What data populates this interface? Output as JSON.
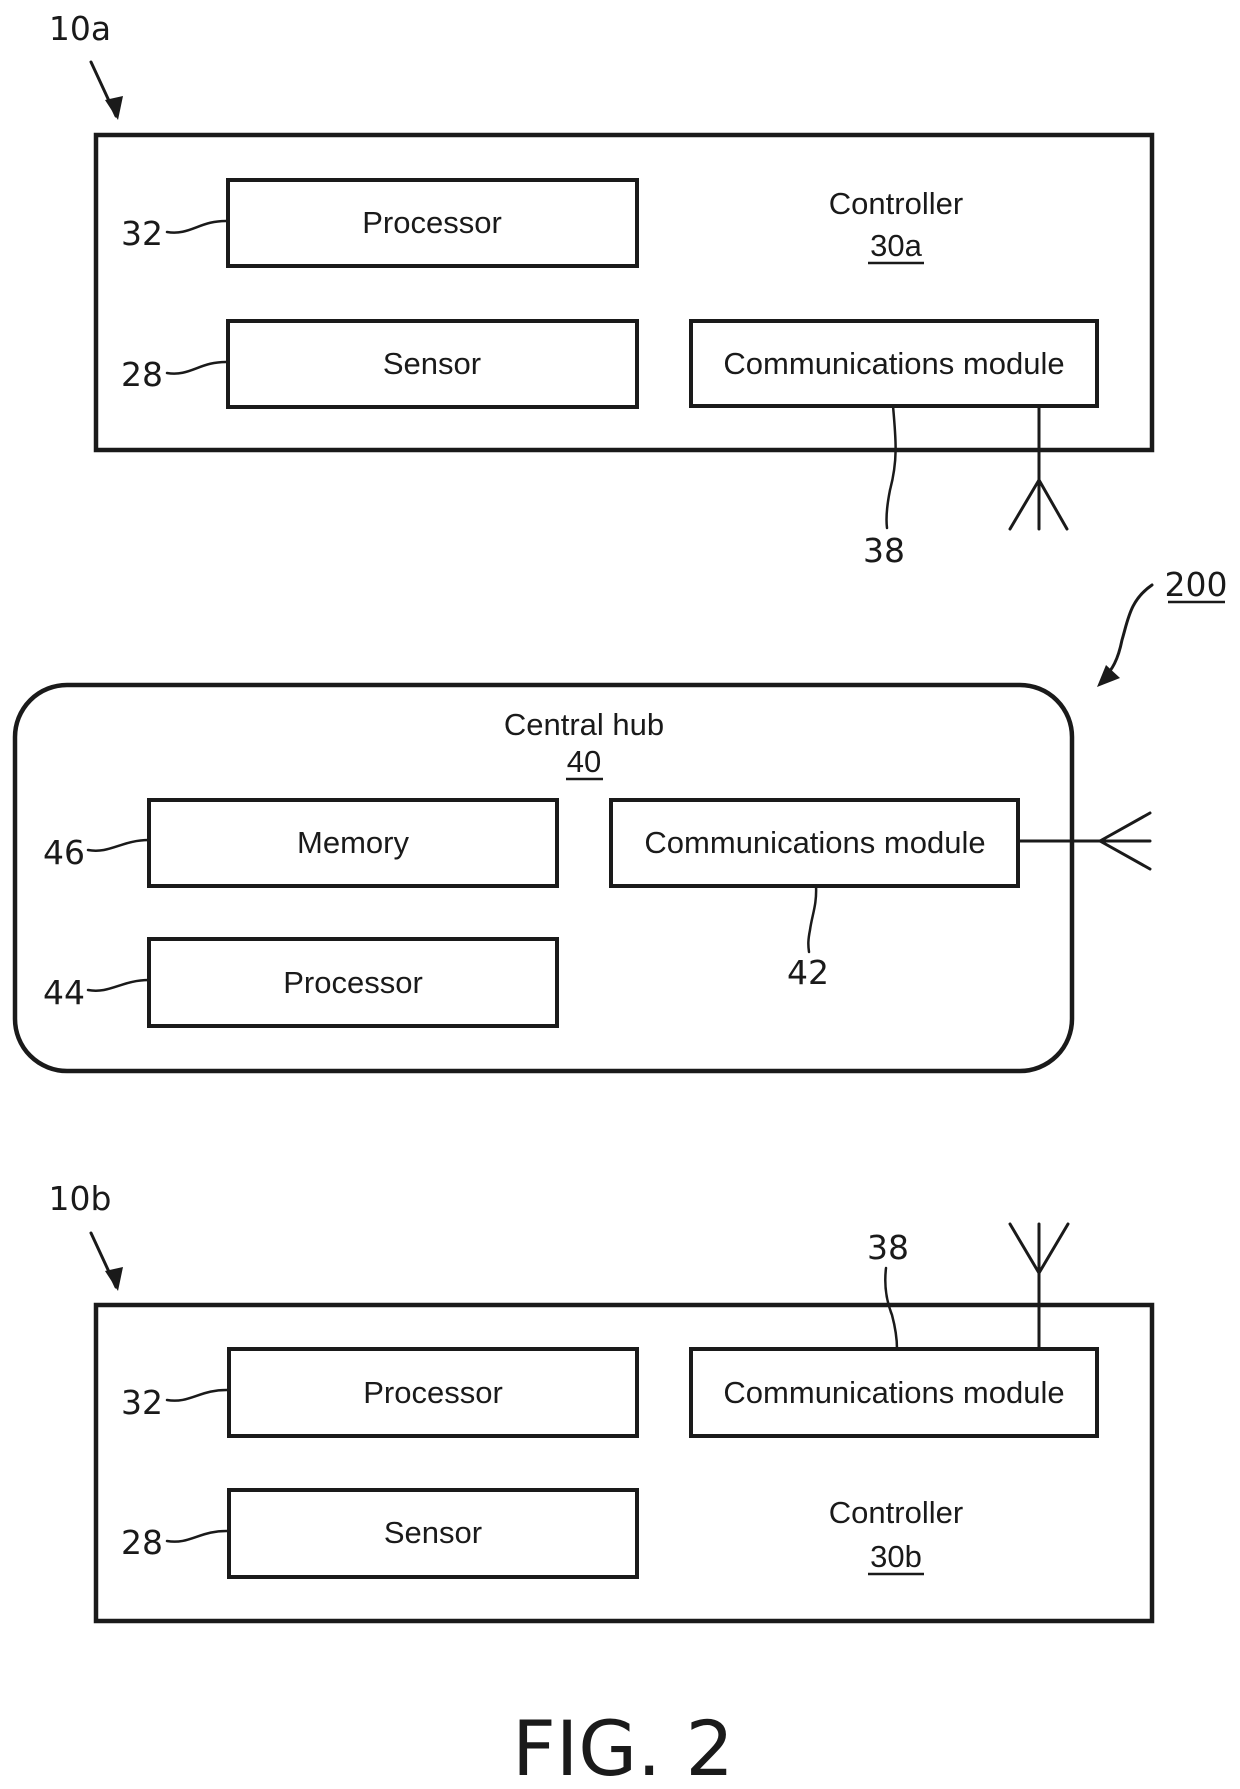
{
  "figure": {
    "caption": "FIG. 2"
  },
  "system": {
    "ref": "200"
  },
  "device_a": {
    "ref": "10a",
    "controller": {
      "title": "Controller",
      "ref": "30a"
    },
    "processor": {
      "label": "Processor",
      "ref": "32"
    },
    "sensor": {
      "label": "Sensor",
      "ref": "28"
    },
    "comms": {
      "label": "Communications module",
      "ref": "38"
    }
  },
  "hub": {
    "title": "Central hub",
    "ref": "40",
    "memory": {
      "label": "Memory",
      "ref": "46"
    },
    "processor": {
      "label": "Processor",
      "ref": "44"
    },
    "comms": {
      "label": "Communications module",
      "ref": "42"
    }
  },
  "device_b": {
    "ref": "10b",
    "controller": {
      "title": "Controller",
      "ref": "30b"
    },
    "processor": {
      "label": "Processor",
      "ref": "32"
    },
    "sensor": {
      "label": "Sensor",
      "ref": "28"
    },
    "comms": {
      "label": "Communications module",
      "ref": "38"
    }
  }
}
